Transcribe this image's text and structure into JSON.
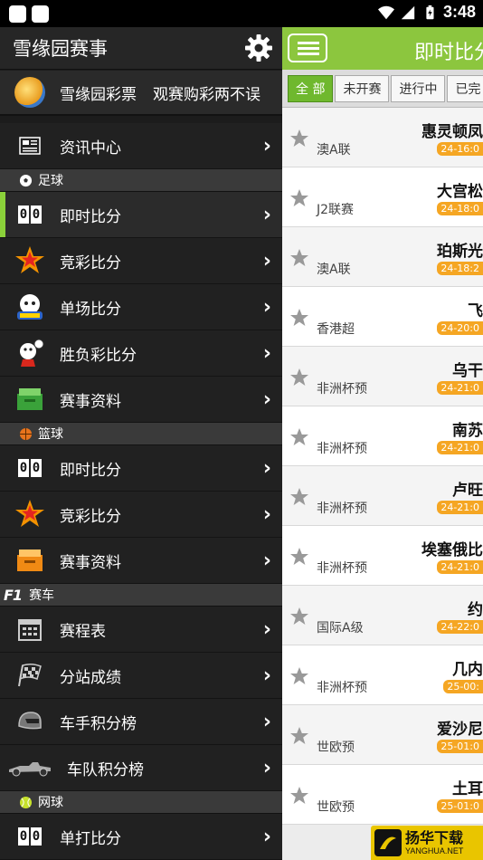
{
  "status_bar": {
    "time": "3:48"
  },
  "drawer": {
    "title": "雪缘园赛事",
    "promo": {
      "label": "雪缘园彩票",
      "slogan": "观赛购彩两不误"
    },
    "news": {
      "label": "资讯中心"
    },
    "sections": [
      {
        "title": "足球",
        "items": [
          {
            "label": "即时比分",
            "active": true
          },
          {
            "label": "竞彩比分"
          },
          {
            "label": "单场比分"
          },
          {
            "label": "胜负彩比分"
          },
          {
            "label": "赛事资料"
          }
        ]
      },
      {
        "title": "篮球",
        "items": [
          {
            "label": "即时比分"
          },
          {
            "label": "竞彩比分"
          },
          {
            "label": "赛事资料"
          }
        ]
      },
      {
        "title": "赛车",
        "items": [
          {
            "label": "赛程表"
          },
          {
            "label": "分站成绩"
          },
          {
            "label": "车手积分榜"
          },
          {
            "label": "车队积分榜"
          }
        ]
      },
      {
        "title": "网球",
        "items": [
          {
            "label": "单打比分"
          }
        ]
      }
    ],
    "score_icon_text": "00",
    "f1_logo_text": "F1"
  },
  "main": {
    "title": "即时比分",
    "tabs": [
      "全 部",
      "未开赛",
      "进行中",
      "已完"
    ],
    "matches": [
      {
        "team": "惠灵顿凤",
        "league": "澳A联",
        "time": "24-16:0"
      },
      {
        "team": "大宫松",
        "league": "J2联赛",
        "time": "24-18:0"
      },
      {
        "team": "珀斯光",
        "league": "澳A联",
        "time": "24-18:2"
      },
      {
        "team": "飞",
        "league": "香港超",
        "time": "24-20:0"
      },
      {
        "team": "乌干",
        "league": "非洲杯预",
        "time": "24-21:0"
      },
      {
        "team": "南苏",
        "league": "非洲杯预",
        "time": "24-21:0"
      },
      {
        "team": "卢旺",
        "league": "非洲杯预",
        "time": "24-21:0"
      },
      {
        "team": "埃塞俄比",
        "league": "非洲杯预",
        "time": "24-21:0"
      },
      {
        "team": "约",
        "league": "国际A级",
        "time": "24-22:0"
      },
      {
        "team": "几内",
        "league": "非洲杯预",
        "time": "25-00:"
      },
      {
        "team": "爱沙尼",
        "league": "世欧预",
        "time": "25-01:0"
      },
      {
        "team": "土耳",
        "league": "世欧预",
        "time": "25-01:0"
      }
    ]
  },
  "watermark": {
    "cn": "扬华下载",
    "en": "YANGHUA.NET"
  },
  "colors": {
    "accent": "#8cc63e",
    "badge": "#f5a623",
    "drawer_bg": "#1c1c1c"
  }
}
